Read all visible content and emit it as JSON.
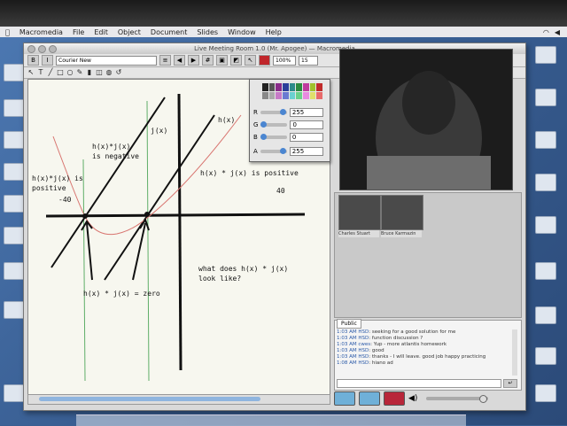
{
  "menubar": {
    "items": [
      "Macromedia",
      "File",
      "Edit",
      "Object",
      "Document",
      "Slides",
      "Window",
      "Help"
    ]
  },
  "window": {
    "title": "Live Meeting Room 1.0 (Mr. Apogee) — Macromedia",
    "font_select": "Courier New",
    "zoom": "100%",
    "page_number": "15"
  },
  "colorpicker": {
    "rows": [
      {
        "label": "R",
        "value": "255"
      },
      {
        "label": "G",
        "value": "0"
      },
      {
        "label": "B",
        "value": "0"
      },
      {
        "label": "A",
        "value": "255"
      }
    ]
  },
  "whiteboard": {
    "label_jx": "j(x)",
    "label_hx": "h(x)",
    "label_product_negative": "h(x)*j(x)\nis negative",
    "label_product_positive_left": "h(x)*j(x) is\npositive",
    "label_neg40": "-40",
    "label_product_positive_right": "h(x) * j(x) is positive",
    "label_40": "40",
    "label_zero": "h(x) * j(x) = zero",
    "label_question": "what does h(x) * j(x)\nlook like?"
  },
  "thumbs": [
    {
      "name": "Charles Stuart"
    },
    {
      "name": "Bruce Karmazin"
    }
  ],
  "chat": {
    "tab": "Public",
    "lines": [
      {
        "time": "1:03 AM",
        "who": "HSD",
        "text": "seeking for a good solution for me"
      },
      {
        "time": "1:03 AM",
        "who": "HSD",
        "text": "function discussion ?"
      },
      {
        "time": "1:03 AM",
        "who": "cwes",
        "text": "Yup - more atlantis homework"
      },
      {
        "time": "1:03 AM",
        "who": "HSD",
        "text": "good"
      },
      {
        "time": "1:03 AM",
        "who": "HSD",
        "text": "thanks - I will leave. good job happy practicing"
      },
      {
        "time": "1:08 AM",
        "who": "HSD",
        "text": "hiano ad"
      }
    ]
  },
  "colors": {
    "accent": "#4b86d1",
    "graph_black": "#111111",
    "graph_green": "#5fae68",
    "graph_red": "#d8746f"
  },
  "icons": [
    "close-icon",
    "minimize-icon",
    "zoom-icon",
    "bold-icon",
    "arrow-tool-icon",
    "pen-tool-icon",
    "line-tool-icon",
    "send-icon",
    "speaker-icon",
    "camera-icon"
  ]
}
